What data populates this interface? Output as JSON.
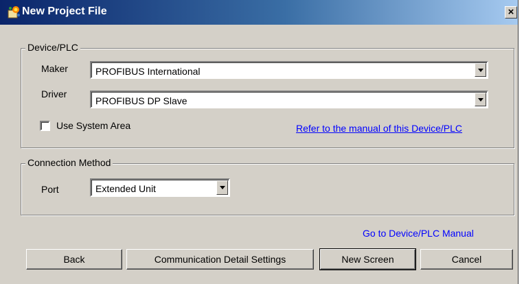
{
  "window": {
    "title": "New Project File",
    "close_label": "×"
  },
  "device_group": {
    "label": "Device/PLC",
    "maker_label": "Maker",
    "maker_value": "PROFIBUS International",
    "driver_label": "Driver",
    "driver_value": "PROFIBUS DP Slave",
    "use_system_area_label": "Use System Area",
    "use_system_area_checked": false,
    "manual_link": "Refer to the manual of this Device/PLC"
  },
  "connection_group": {
    "label": "Connection Method",
    "port_label": "Port",
    "port_value": "Extended Unit"
  },
  "manual_link_bottom": "Go to Device/PLC Manual",
  "buttons": {
    "back": "Back",
    "comm_settings": "Communication Detail Settings",
    "new_screen": "New Screen",
    "cancel": "Cancel"
  }
}
